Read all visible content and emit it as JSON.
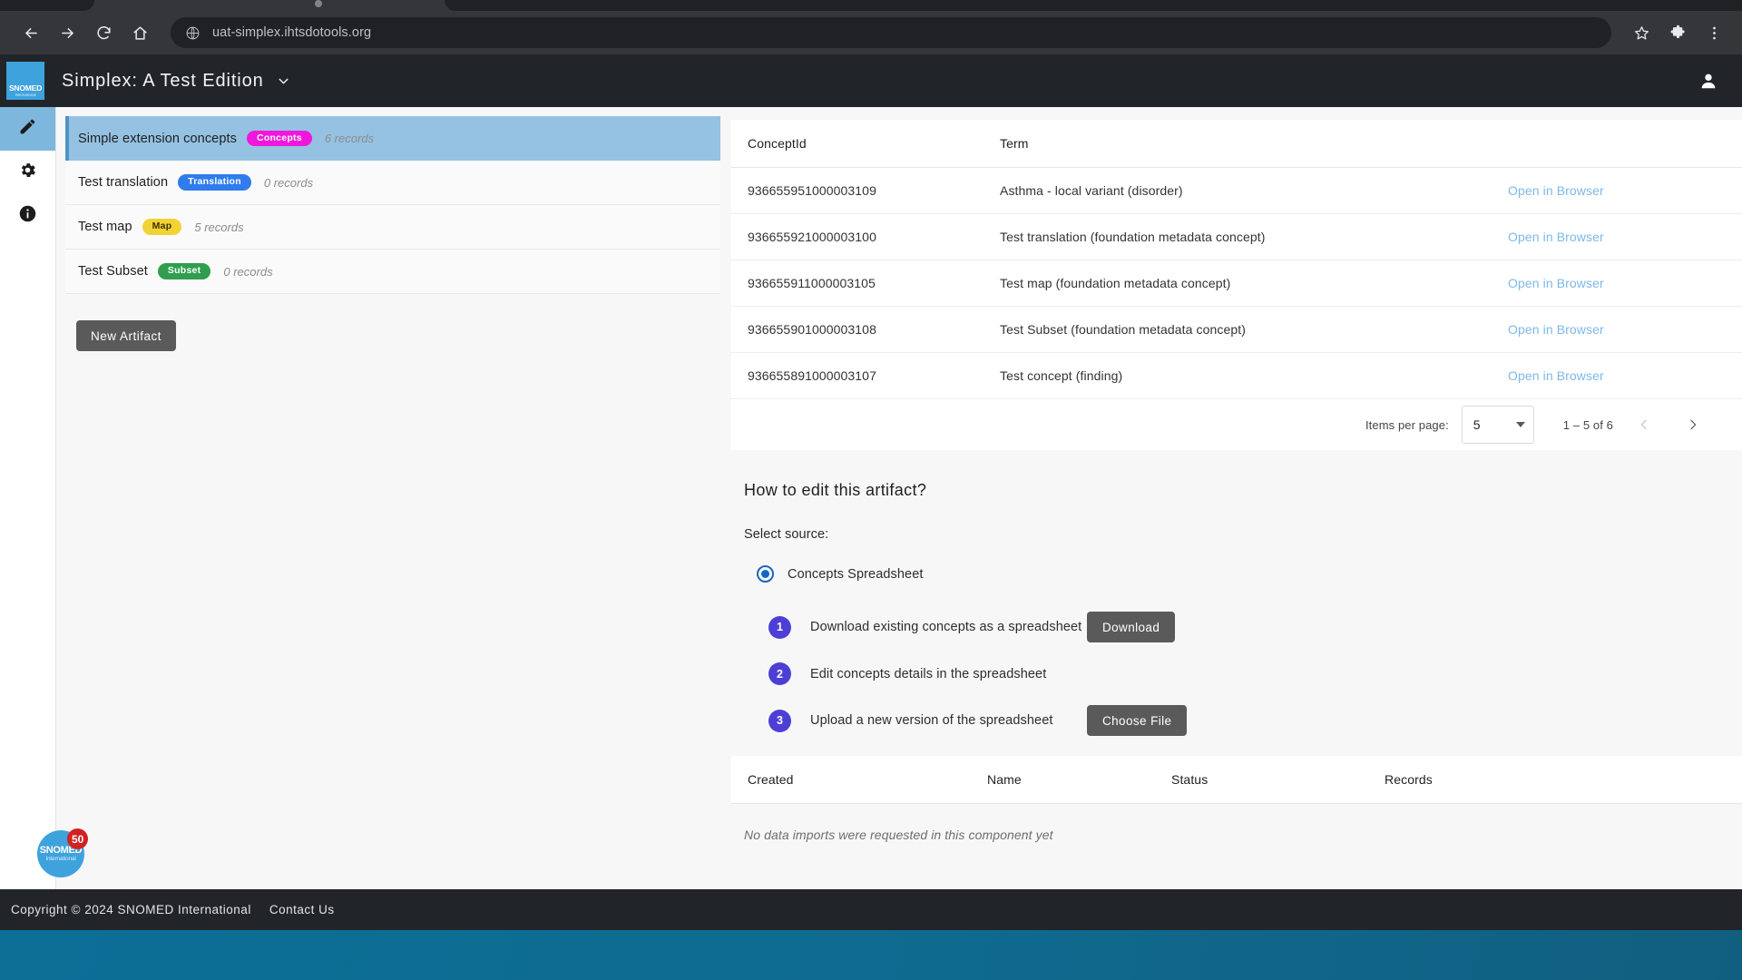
{
  "browser": {
    "url": "uat-simplex.ihtsdotools.org",
    "back_label": "Back",
    "forward_label": "Forward",
    "reload_label": "Reload",
    "home_label": "Home",
    "bookmark_label": "Bookmark this tab",
    "extensions_label": "Extensions",
    "menu_label": "Customize and control"
  },
  "appbar": {
    "logo_line1": "SNOMED",
    "logo_line2": "International",
    "title": "Simplex: A Test Edition",
    "account_label": "Account"
  },
  "rail": {
    "items": [
      {
        "name": "edit",
        "label": "Edit",
        "active": true
      },
      {
        "name": "settings",
        "label": "Settings",
        "active": false
      },
      {
        "name": "info",
        "label": "Info",
        "active": false
      }
    ]
  },
  "artifacts": {
    "items": [
      {
        "name": "Simple extension concepts",
        "badge": "Concepts",
        "badge_type": "concepts",
        "records": "6 records",
        "selected": true
      },
      {
        "name": "Test translation",
        "badge": "Translation",
        "badge_type": "translation",
        "records": "0 records",
        "selected": false
      },
      {
        "name": "Test map",
        "badge": "Map",
        "badge_type": "map",
        "records": "5 records",
        "selected": false
      },
      {
        "name": "Test Subset",
        "badge": "Subset",
        "badge_type": "subset",
        "records": "0 records",
        "selected": false
      }
    ],
    "new_artifact_label": "New Artifact"
  },
  "concepts_table": {
    "columns": [
      "ConceptId",
      "Term",
      ""
    ],
    "action_label": "Open in Browser",
    "rows": [
      {
        "concept_id": "936655951000003109",
        "term": "Asthma - local variant (disorder)",
        "action": "Open in Browser"
      },
      {
        "concept_id": "936655921000003100",
        "term": "Test translation (foundation metadata concept)",
        "action": "Open in Browser"
      },
      {
        "concept_id": "936655911000003105",
        "term": "Test map (foundation metadata concept)",
        "action": "Open in Browser"
      },
      {
        "concept_id": "936655901000003108",
        "term": "Test Subset (foundation metadata concept)",
        "action": "Open in Browser"
      },
      {
        "concept_id": "936655891000003107",
        "term": "Test concept (finding)",
        "action": "Open in Browser"
      }
    ]
  },
  "paginator": {
    "items_per_page_label": "Items per page:",
    "page_size": "5",
    "range_label": "1 – 5 of 6",
    "prev_label": "Previous page",
    "next_label": "Next page"
  },
  "howto": {
    "heading": "How to edit this artifact?",
    "select_source_label": "Select source:",
    "source_option": "Concepts Spreadsheet",
    "steps": [
      {
        "num": "1",
        "text": "Download existing concepts as a spreadsheet",
        "button": "Download"
      },
      {
        "num": "2",
        "text": "Edit concepts details in the spreadsheet",
        "button": ""
      },
      {
        "num": "3",
        "text": "Upload a new version of the spreadsheet",
        "button": "Choose File"
      }
    ]
  },
  "imports_table": {
    "columns": [
      "Created",
      "Name",
      "Status",
      "Records"
    ],
    "empty_message": "No data imports were requested in this component yet"
  },
  "support_widget": {
    "line1": "SNOMED",
    "line2": "International",
    "badge_count": "50"
  },
  "footer": {
    "copyright": "Copyright © 2024 SNOMED International",
    "contact": "Contact Us"
  },
  "colors": {
    "accent_blue": "#3ea2dd",
    "selected_row": "#95c2e2",
    "badge_concepts": "#f216dd",
    "badge_translation": "#2f7ced",
    "badge_map": "#f2d335",
    "badge_subset": "#2f9e4f",
    "step_circle": "#4d3fd6",
    "radio": "#1667c2",
    "link": "#7db8ea",
    "button_dark": "#5a5a5a"
  }
}
